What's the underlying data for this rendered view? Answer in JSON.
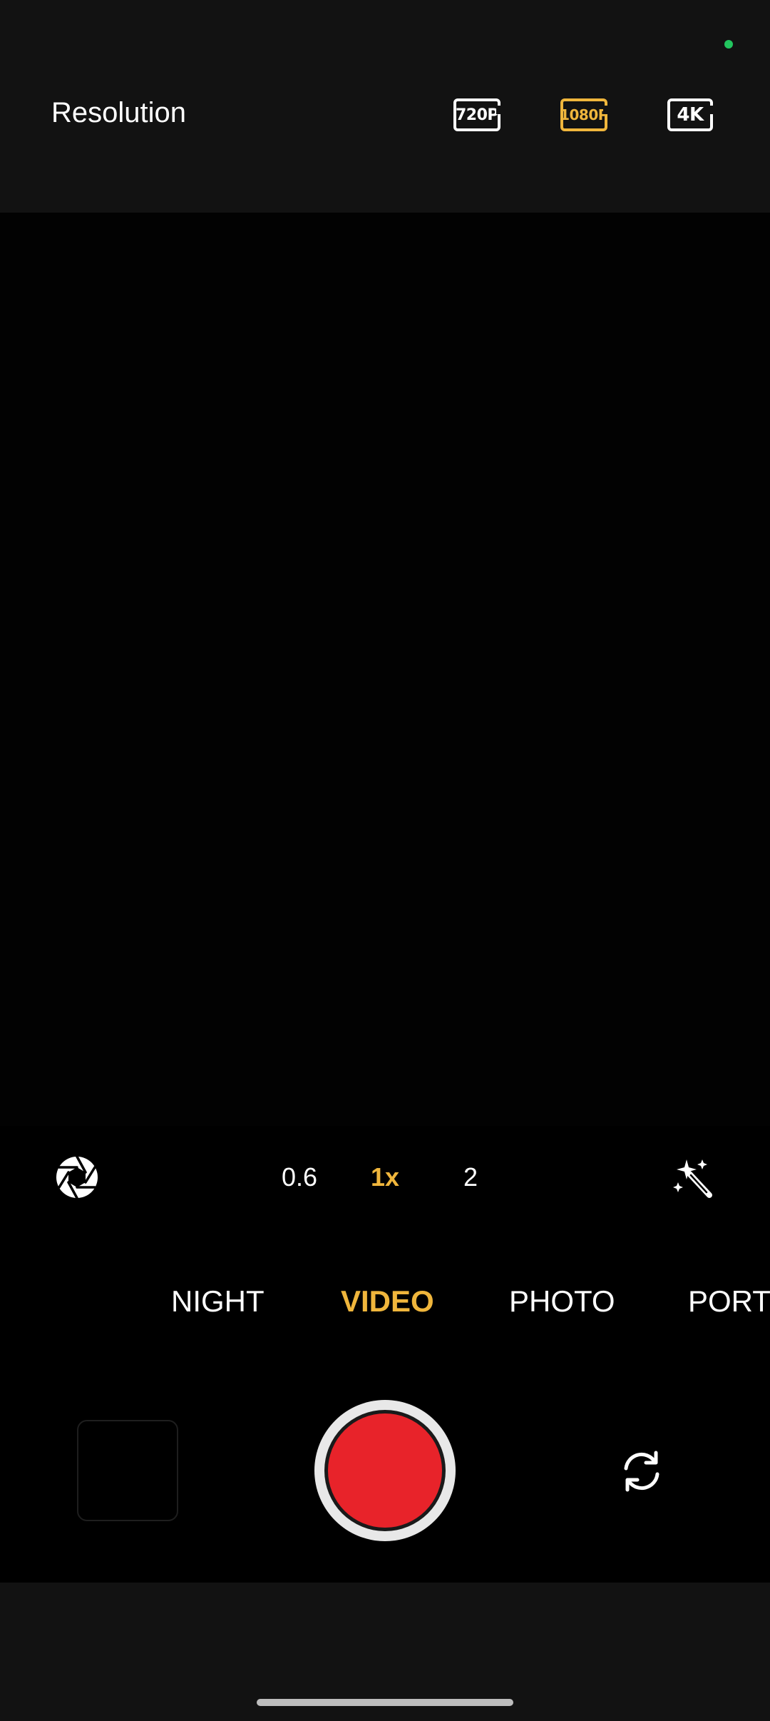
{
  "top": {
    "resolution_label": "Resolution",
    "options": [
      {
        "label": "720P",
        "selected": false
      },
      {
        "label": "1080P",
        "selected": true
      },
      {
        "label": "4K",
        "selected": false
      }
    ]
  },
  "zoom": {
    "options": [
      {
        "label": "0.6",
        "selected": false
      },
      {
        "label": "1x",
        "selected": true
      },
      {
        "label": "2",
        "selected": false
      }
    ]
  },
  "modes": {
    "items": [
      {
        "label": "NIGHT",
        "selected": false
      },
      {
        "label": "VIDEO",
        "selected": true
      },
      {
        "label": "PHOTO",
        "selected": false
      },
      {
        "label": "PORTRAIT",
        "selected": false
      }
    ]
  },
  "icons": {
    "aperture": "aperture-icon",
    "magic_wand": "magic-wand-icon",
    "flip_camera": "flip-camera-icon"
  },
  "colors": {
    "accent": "#f0b63c",
    "record": "#e8232a",
    "status_dot": "#22c55e"
  }
}
